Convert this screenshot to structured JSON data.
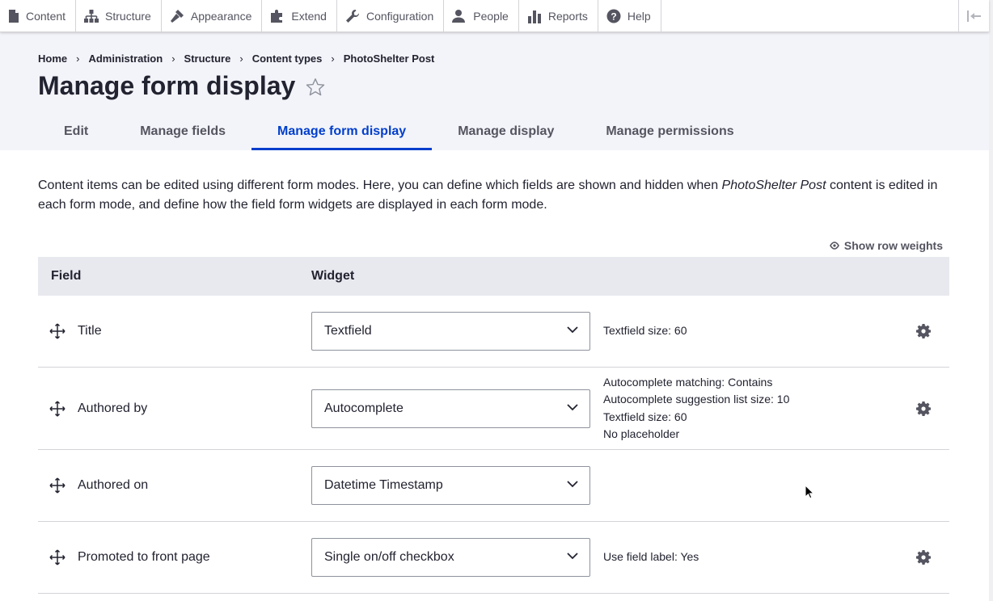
{
  "toolbar": {
    "items": [
      {
        "label": "Content",
        "icon": "content-icon"
      },
      {
        "label": "Structure",
        "icon": "structure-icon"
      },
      {
        "label": "Appearance",
        "icon": "appearance-icon"
      },
      {
        "label": "Extend",
        "icon": "extend-icon"
      },
      {
        "label": "Configuration",
        "icon": "wrench-icon"
      },
      {
        "label": "People",
        "icon": "people-icon"
      },
      {
        "label": "Reports",
        "icon": "reports-icon"
      },
      {
        "label": "Help",
        "icon": "help-icon"
      }
    ]
  },
  "breadcrumb": [
    "Home",
    "Administration",
    "Structure",
    "Content types",
    "PhotoShelter Post"
  ],
  "page": {
    "title": "Manage form display"
  },
  "tabs": [
    {
      "label": "Edit",
      "active": false
    },
    {
      "label": "Manage fields",
      "active": false
    },
    {
      "label": "Manage form display",
      "active": true
    },
    {
      "label": "Manage display",
      "active": false
    },
    {
      "label": "Manage permissions",
      "active": false
    }
  ],
  "description": {
    "part1": "Content items can be edited using different form modes. Here, you can define which fields are shown and hidden when ",
    "emphasis": "PhotoShelter Post",
    "part2": " content is edited in each form mode, and define how the field form widgets are displayed in each form mode."
  },
  "show_row_weights": "Show row weights",
  "table": {
    "headers": {
      "field": "Field",
      "widget": "Widget"
    },
    "rows": [
      {
        "field": "Title",
        "widget": "Textfield",
        "summary": [
          "Textfield size: 60"
        ],
        "has_settings": true
      },
      {
        "field": "Authored by",
        "widget": "Autocomplete",
        "summary": [
          "Autocomplete matching: Contains",
          "Autocomplete suggestion list size: 10",
          "Textfield size: 60",
          "No placeholder"
        ],
        "has_settings": true
      },
      {
        "field": "Authored on",
        "widget": "Datetime Timestamp",
        "summary": [],
        "has_settings": false
      },
      {
        "field": "Promoted to front page",
        "widget": "Single on/off checkbox",
        "summary": [
          "Use field label: Yes"
        ],
        "has_settings": true
      }
    ]
  },
  "colors": {
    "accent": "#003ecc",
    "header_bg": "#f3f4f9",
    "table_head_bg": "#e8e9ef",
    "text": "#222330",
    "muted": "#545560"
  }
}
